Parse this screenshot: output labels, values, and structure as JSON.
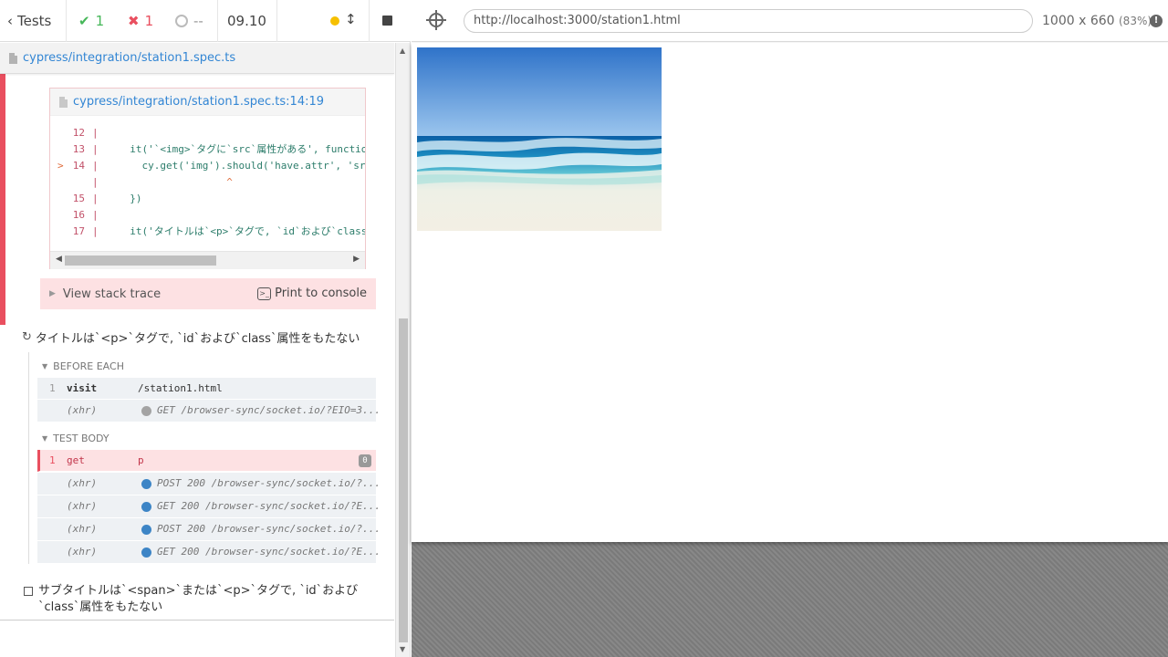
{
  "reporter": {
    "tests_label": "Tests",
    "passed": "1",
    "failed": "1",
    "pending": "--",
    "duration": "09.10",
    "spec_path": "cypress/integration/station1.spec.ts"
  },
  "error": {
    "codeframe_file": "cypress/integration/station1.spec.ts:14:19",
    "lines": [
      {
        "num": "12",
        "mark": "",
        "code": ""
      },
      {
        "num": "13",
        "mark": "",
        "code": "  it('`<img>`タグに`src`属性がある', function () {"
      },
      {
        "num": "14",
        "mark": ">",
        "code": "    cy.get('img').should('have.attr', 'src')"
      },
      {
        "num": "",
        "mark": "",
        "code": "                  ^"
      },
      {
        "num": "15",
        "mark": "",
        "code": "  })"
      },
      {
        "num": "16",
        "mark": "",
        "code": ""
      },
      {
        "num": "17",
        "mark": "",
        "code": "  it('タイトルは`<p>`タグで, `id`および`class`属性をもたない'"
      }
    ],
    "view_stack_trace": "View stack trace",
    "print_to_console": "Print to console"
  },
  "test2": {
    "title": "タイトルは`<p>`タグで, `id`および`class`属性をもたない",
    "before_each_label": "BEFORE EACH",
    "before_each": [
      {
        "idx": "1",
        "name": "visit",
        "message": "/station1.html",
        "xhr": false
      },
      {
        "idx": "",
        "name": "(xhr)",
        "message": "GET /browser-sync/socket.io/?EIO=3...",
        "xhr": true,
        "dot_color": "#a3a3a3"
      }
    ],
    "test_body_label": "TEST BODY",
    "test_body": [
      {
        "idx": "1",
        "name": "get",
        "message": "p",
        "xhr": false,
        "failed": true,
        "badge": "0"
      },
      {
        "idx": "",
        "name": "(xhr)",
        "message": "POST 200 /browser-sync/socket.io/?...",
        "xhr": true,
        "dot_color": "#3d85c6"
      },
      {
        "idx": "",
        "name": "(xhr)",
        "message": "GET 200 /browser-sync/socket.io/?E...",
        "xhr": true,
        "dot_color": "#3d85c6"
      },
      {
        "idx": "",
        "name": "(xhr)",
        "message": "POST 200 /browser-sync/socket.io/?...",
        "xhr": true,
        "dot_color": "#3d85c6"
      },
      {
        "idx": "",
        "name": "(xhr)",
        "message": "GET 200 /browser-sync/socket.io/?E...",
        "xhr": true,
        "dot_color": "#3d85c6"
      }
    ]
  },
  "test3": {
    "title_line1": "サブタイトルは`<span>`または`<p>`タグで, `id`および",
    "title_line2": "`class`属性をもたない"
  },
  "aut": {
    "url": "http://localhost:3000/station1.html",
    "viewport": "1000 x 660",
    "scale": "(83%)"
  },
  "colors": {
    "passed": "#46b759",
    "failed": "#e94f5f",
    "link": "#3386d4",
    "autorun": "#f6c000"
  },
  "icons": [
    "chevron-left-icon",
    "check-icon",
    "x-icon",
    "circle-pending-icon",
    "stop-icon",
    "file-icon",
    "refresh-icon",
    "terminal-icon",
    "selector-playground-icon",
    "info-icon"
  ]
}
